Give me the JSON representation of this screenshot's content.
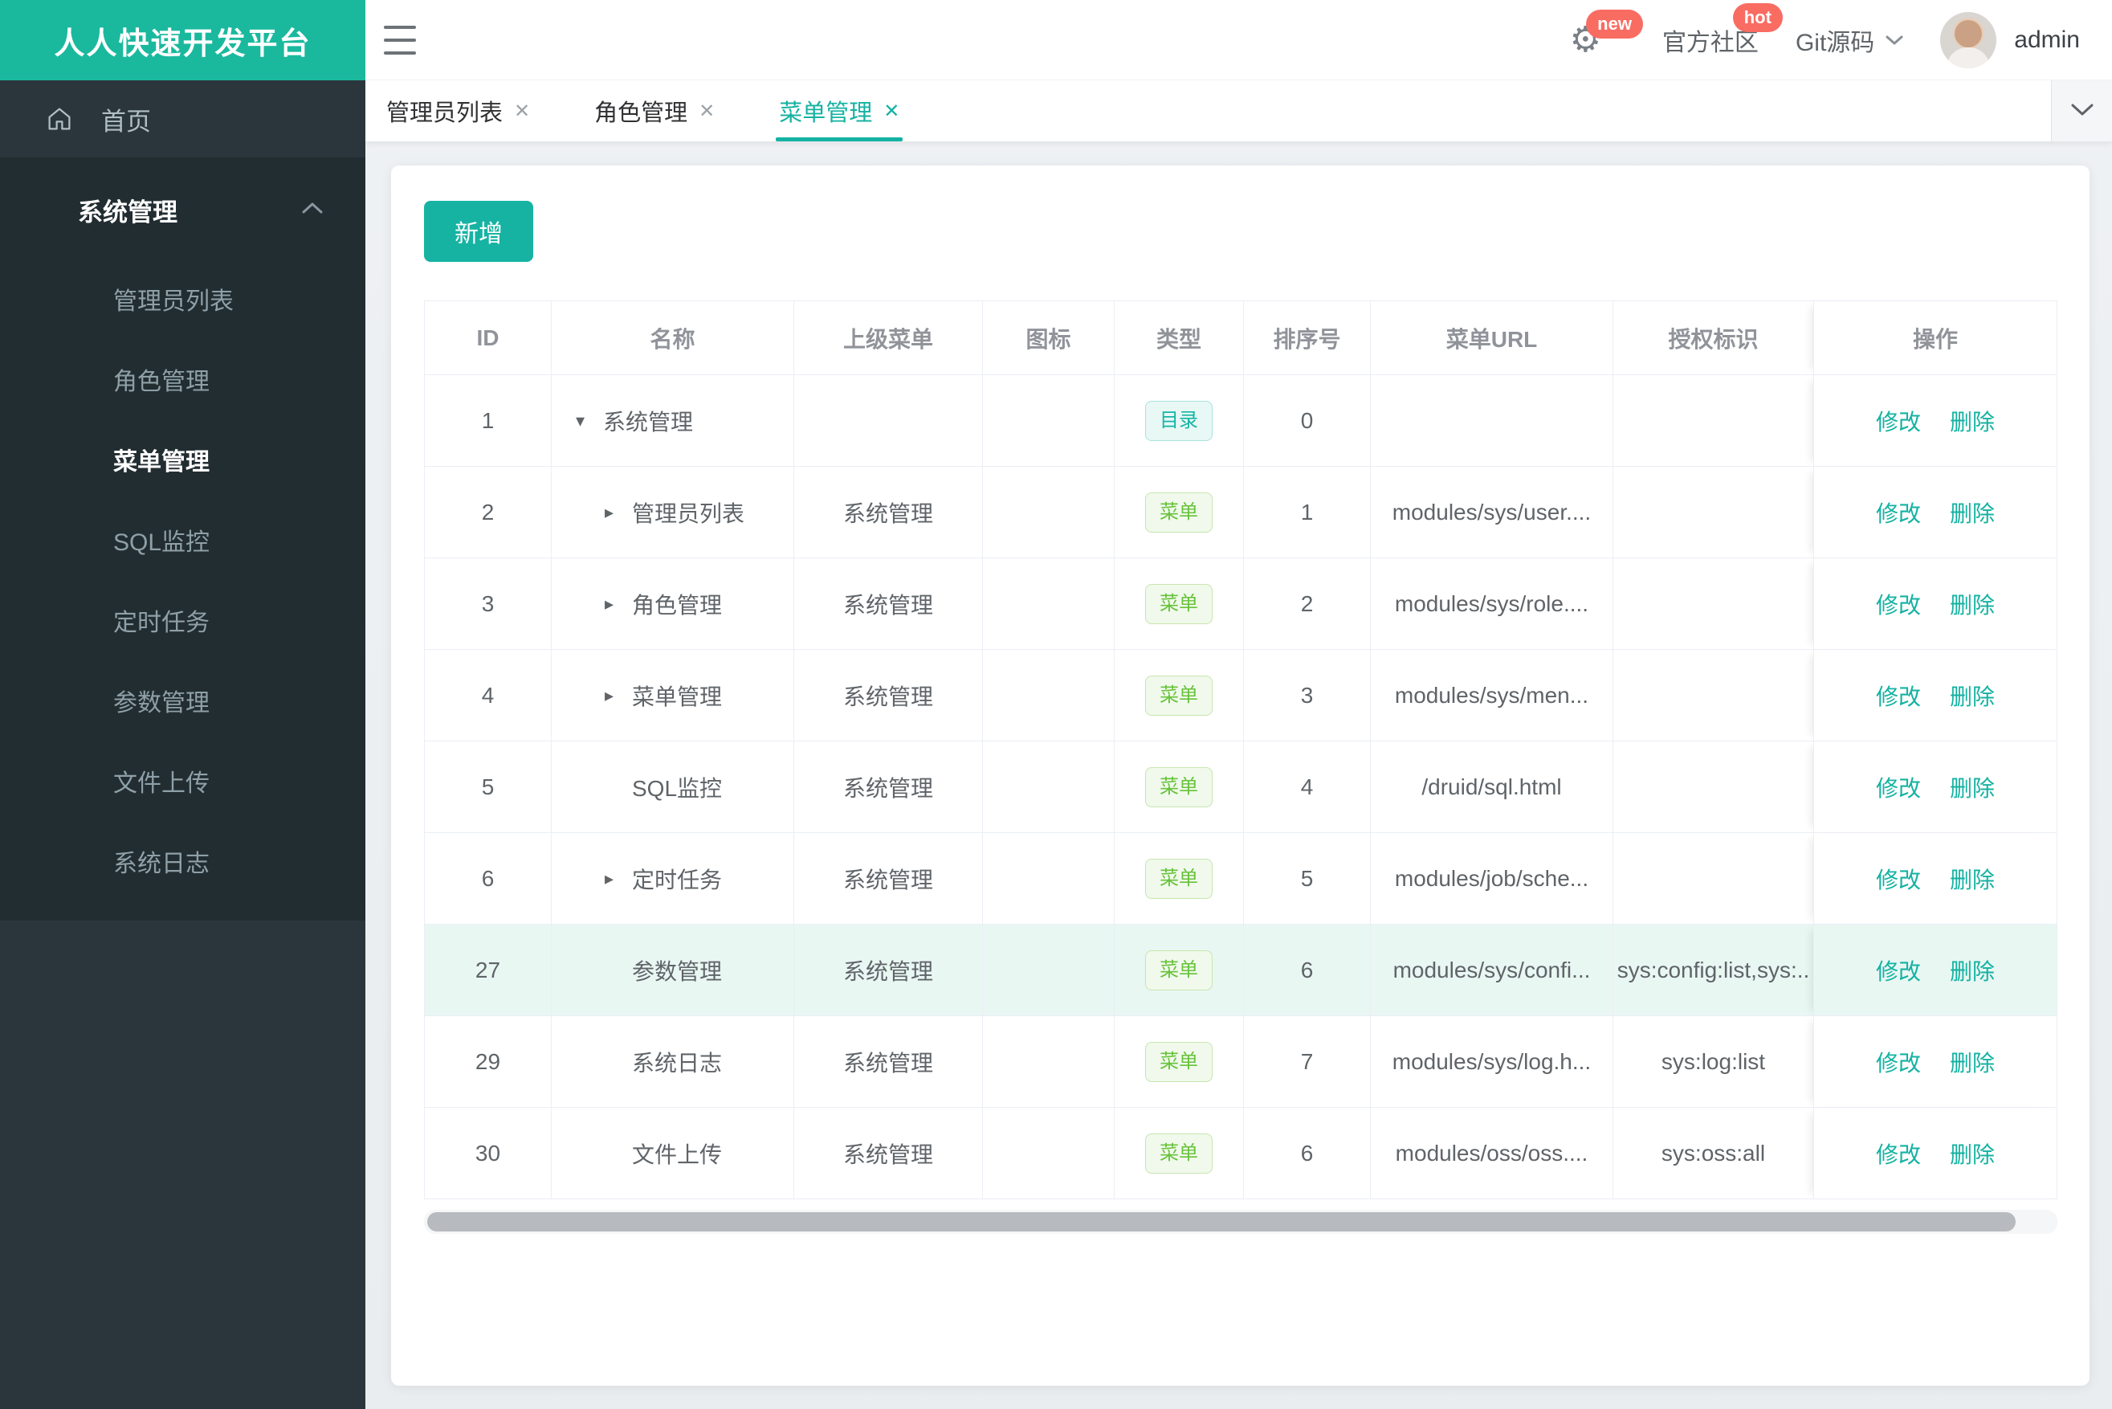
{
  "app": {
    "logo": "人人快速开发平台",
    "header": {
      "gear_badge": "new",
      "community_label": "官方社区",
      "community_badge": "hot",
      "git_label": "Git源码",
      "username": "admin"
    }
  },
  "sidebar": {
    "home_label": "首页",
    "group": {
      "label": "系统管理",
      "items": [
        "管理员列表",
        "角色管理",
        "菜单管理",
        "SQL监控",
        "定时任务",
        "参数管理",
        "文件上传",
        "系统日志"
      ],
      "active_item": "菜单管理"
    }
  },
  "tabs": [
    {
      "label": "管理员列表",
      "active": false
    },
    {
      "label": "角色管理",
      "active": false
    },
    {
      "label": "菜单管理",
      "active": true
    }
  ],
  "toolbar": {
    "add_label": "新增"
  },
  "table": {
    "columns": [
      "ID",
      "名称",
      "上级菜单",
      "图标",
      "类型",
      "排序号",
      "菜单URL",
      "授权标识",
      "操作"
    ],
    "actions": {
      "edit": "修改",
      "delete": "删除"
    },
    "type_labels": {
      "dir": "目录",
      "menu": "菜单"
    },
    "rows": [
      {
        "id": "1",
        "arrow": "expanded",
        "level": 0,
        "name": "系统管理",
        "parent": "",
        "icon": "",
        "type_kind": "dir",
        "order": "0",
        "url": "",
        "auth": "",
        "highlight": false
      },
      {
        "id": "2",
        "arrow": "collapsed",
        "level": 1,
        "name": "管理员列表",
        "parent": "系统管理",
        "icon": "",
        "type_kind": "menu",
        "order": "1",
        "url": "modules/sys/user....",
        "auth": "",
        "highlight": false
      },
      {
        "id": "3",
        "arrow": "collapsed",
        "level": 1,
        "name": "角色管理",
        "parent": "系统管理",
        "icon": "",
        "type_kind": "menu",
        "order": "2",
        "url": "modules/sys/role....",
        "auth": "",
        "highlight": false
      },
      {
        "id": "4",
        "arrow": "collapsed",
        "level": 1,
        "name": "菜单管理",
        "parent": "系统管理",
        "icon": "",
        "type_kind": "menu",
        "order": "3",
        "url": "modules/sys/men...",
        "auth": "",
        "highlight": false
      },
      {
        "id": "5",
        "arrow": "none",
        "level": 1,
        "name": "SQL监控",
        "parent": "系统管理",
        "icon": "",
        "type_kind": "menu",
        "order": "4",
        "url": "/druid/sql.html",
        "auth": "",
        "highlight": false
      },
      {
        "id": "6",
        "arrow": "collapsed",
        "level": 1,
        "name": "定时任务",
        "parent": "系统管理",
        "icon": "",
        "type_kind": "menu",
        "order": "5",
        "url": "modules/job/sche...",
        "auth": "",
        "highlight": false
      },
      {
        "id": "27",
        "arrow": "none",
        "level": 1,
        "name": "参数管理",
        "parent": "系统管理",
        "icon": "",
        "type_kind": "menu",
        "order": "6",
        "url": "modules/sys/confi...",
        "auth": "sys:config:list,sys:..",
        "highlight": true
      },
      {
        "id": "29",
        "arrow": "none",
        "level": 1,
        "name": "系统日志",
        "parent": "系统管理",
        "icon": "",
        "type_kind": "menu",
        "order": "7",
        "url": "modules/sys/log.h...",
        "auth": "sys:log:list",
        "highlight": false
      },
      {
        "id": "30",
        "arrow": "none",
        "level": 1,
        "name": "文件上传",
        "parent": "系统管理",
        "icon": "",
        "type_kind": "menu",
        "order": "6",
        "url": "modules/oss/oss....",
        "auth": "sys:oss:all",
        "highlight": false
      }
    ]
  },
  "colors": {
    "accent": "#14b2a2",
    "logo_bg": "#1ab99e",
    "badge_red": "#f96c62",
    "dir_badge": "#13b5a5",
    "menu_badge": "#67c23a",
    "row_highlight": "#e9f7f3"
  }
}
